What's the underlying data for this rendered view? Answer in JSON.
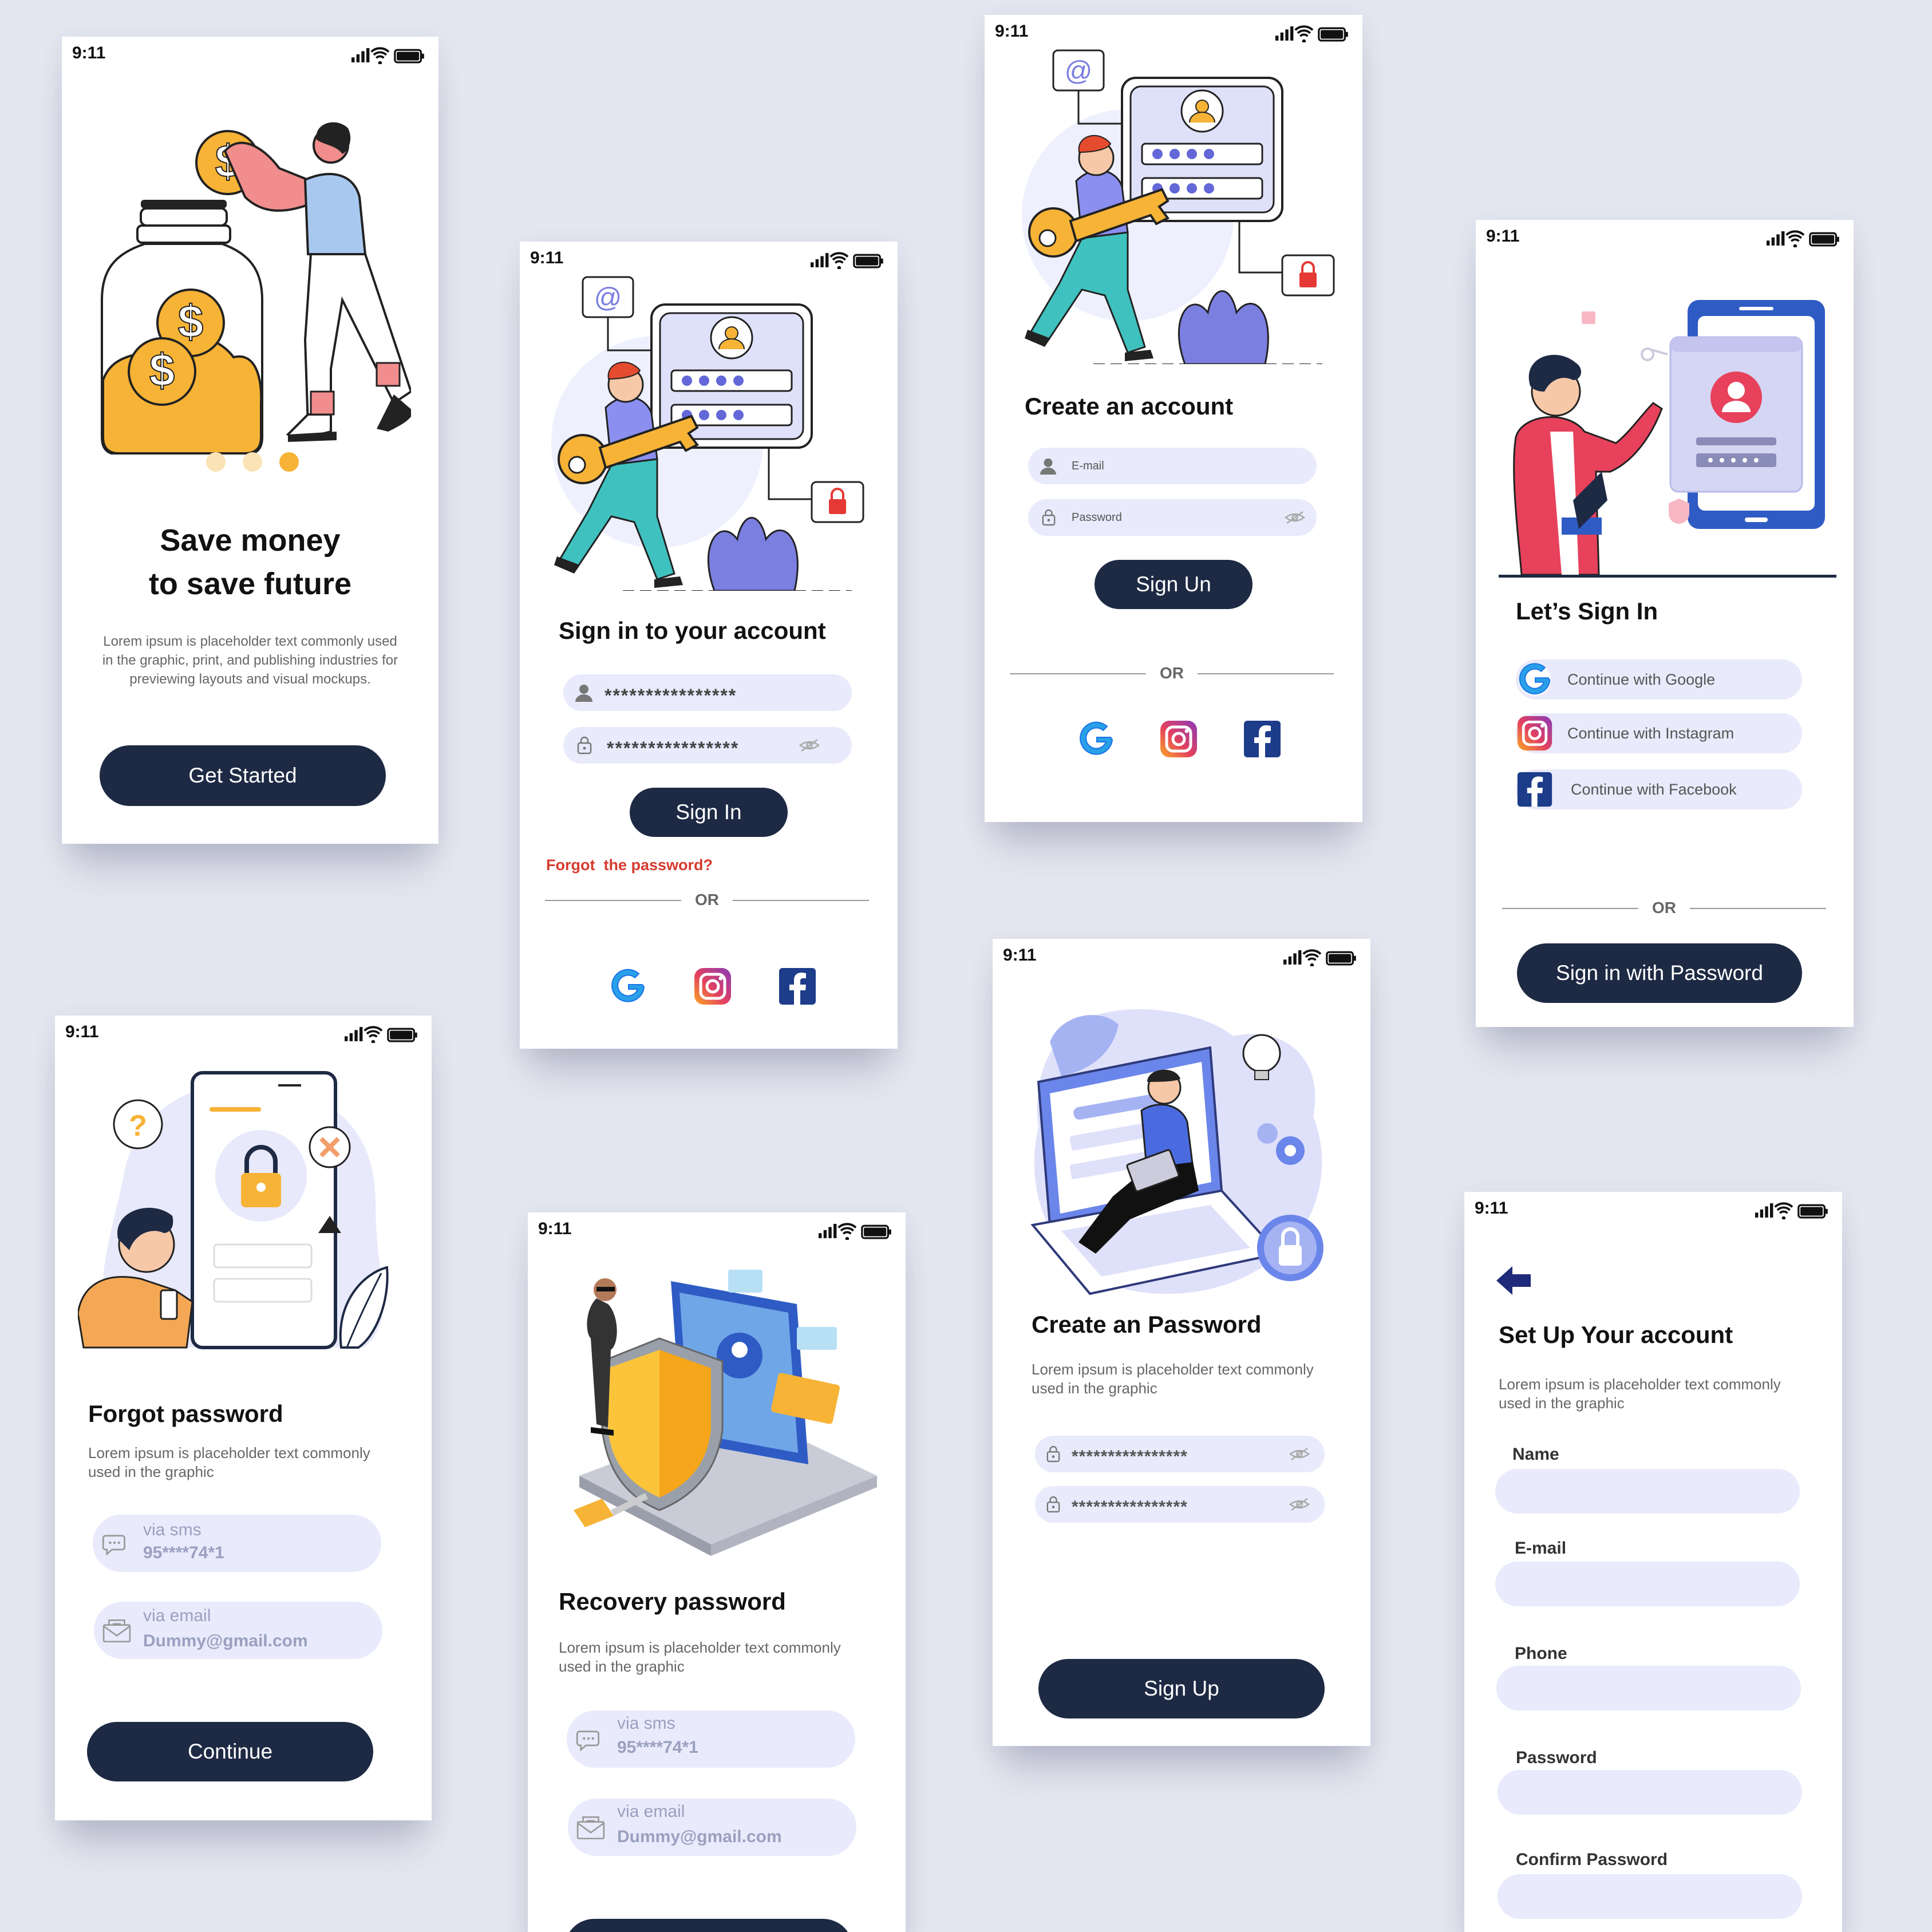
{
  "status_time": "9:11",
  "colors": {
    "dark_button": "#1e2a44",
    "field_bg": "#e9eafb",
    "accent_orange": "#f6b336",
    "accent_purple": "#7b7fe0",
    "forgot_red": "#d63b2f"
  },
  "onboarding": {
    "title_line1": "Save money",
    "title_line2": "to save future",
    "description": "Lorem ipsum is placeholder text commonly used in the graphic, print, and publishing industries for previewing layouts and visual mockups.",
    "button": "Get Started",
    "page_dots": 3,
    "active_dot": 3
  },
  "signin": {
    "title": "Sign in to your account",
    "username_value": "****************",
    "password_value": "****************",
    "button": "Sign In",
    "forgot": "Forgot  the password?",
    "or": "OR",
    "social_icons": [
      "google-icon",
      "instagram-icon",
      "facebook-icon"
    ]
  },
  "create_account": {
    "title": "Create an account",
    "email_placeholder": "E-mail",
    "password_placeholder": "Password",
    "button": "Sign Un",
    "or": "OR"
  },
  "lets_signin": {
    "title": "Let’s Sign In",
    "google": "Continue with Google",
    "instagram": "Continue with Instagram",
    "facebook": "Continue with Facebook",
    "or": "OR",
    "button": "Sign in with Password"
  },
  "forgot": {
    "title": "Forgot password",
    "description": "Lorem ipsum is placeholder text commonly used in the graphic",
    "sms_label": "via sms",
    "sms_value": "95****74*1",
    "email_label": "via email",
    "email_value": "Dummy@gmail.com",
    "button": "Continue"
  },
  "recovery": {
    "title": "Recovery password",
    "description": "Lorem ipsum is placeholder text commonly used in the graphic",
    "sms_label": "via sms",
    "sms_value": "95****74*1",
    "email_label": "via email",
    "email_value": "Dummy@gmail.com"
  },
  "create_password": {
    "title": "Create an Password",
    "description": "Lorem ipsum is placeholder text commonly used in the graphic",
    "password_value": "****************",
    "confirm_value": "****************",
    "button": "Sign Up"
  },
  "setup": {
    "title": "Set Up Your account",
    "description": "Lorem ipsum is placeholder text commonly used in the graphic",
    "name_label": "Name",
    "email_label": "E-mail",
    "phone_label": "Phone",
    "password_label": "Password",
    "confirm_label": "Confirm Password"
  }
}
